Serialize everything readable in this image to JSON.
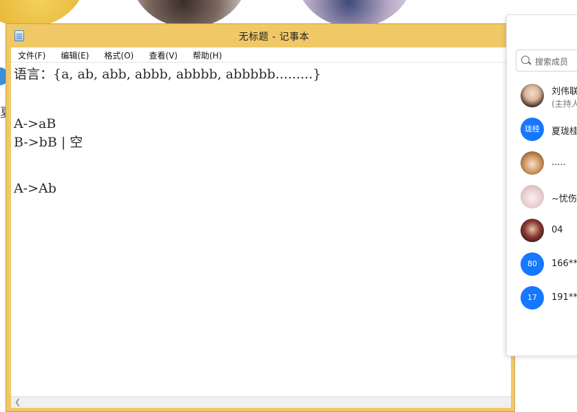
{
  "window": {
    "title": "无标题 - 记事本"
  },
  "menu": {
    "items": [
      "文件(F)",
      "编辑(E)",
      "格式(O)",
      "查看(V)",
      "帮助(H)"
    ]
  },
  "document": {
    "lines": [
      "语言：{a, ab, abb, abbb, abbbb, abbbbb.........}",
      "A->aB",
      "B->bB | 空",
      "A->Ab"
    ]
  },
  "background": {
    "side_char": "夏"
  },
  "members_panel": {
    "search_placeholder": "搜索成员",
    "members": [
      {
        "name": "刘伟联",
        "sub": "(主持人",
        "avatar_type": "photo-woman",
        "avatar_color": "#c9a58a"
      },
      {
        "name": "夏珑桂",
        "avatar_text": "珑桂",
        "avatar_type": "text",
        "avatar_color": "#1677ff"
      },
      {
        "name": ".....",
        "avatar_type": "photo-dog",
        "avatar_color": "#c98e5a"
      },
      {
        "name": "~忧伤",
        "avatar_type": "photo-anime",
        "avatar_color": "#efd9dc"
      },
      {
        "name": "04",
        "avatar_type": "photo-dark",
        "avatar_color": "#6b2e2a"
      },
      {
        "name": "166**",
        "avatar_text": "80",
        "avatar_type": "text",
        "avatar_color": "#1677ff"
      },
      {
        "name": "191**",
        "avatar_text": "17",
        "avatar_type": "text",
        "avatar_color": "#1677ff"
      }
    ]
  }
}
